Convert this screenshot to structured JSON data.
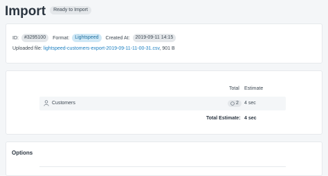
{
  "header": {
    "title": "Import",
    "status": "Ready to Import"
  },
  "details": {
    "id_label": "ID:",
    "id_value": "#3295100",
    "format_label": "Format:",
    "format_value": "Lightspeed",
    "created_label": "Created At:",
    "created_value": "2019-09-11 14:15",
    "uploaded_label": "Uploaded file:",
    "uploaded_file": "lightspeed-customers-export-2019-09-11-11-00-31.csv",
    "uploaded_size": ", 901 B"
  },
  "summary": {
    "columns": {
      "total": "Total",
      "estimate": "Estimate"
    },
    "rows": [
      {
        "icon": "user-icon",
        "label": "Customers",
        "count": "2",
        "estimate": "4 sec"
      }
    ],
    "total_label": "Total Estimate:",
    "total_value": "4 sec"
  },
  "options": {
    "title": "Options"
  },
  "colors": {
    "link": "#1a7ec0",
    "format_badge_bg": "#cfe8f6",
    "badge_bg": "#e4e7ea",
    "page_bg": "#f4f6f8"
  }
}
